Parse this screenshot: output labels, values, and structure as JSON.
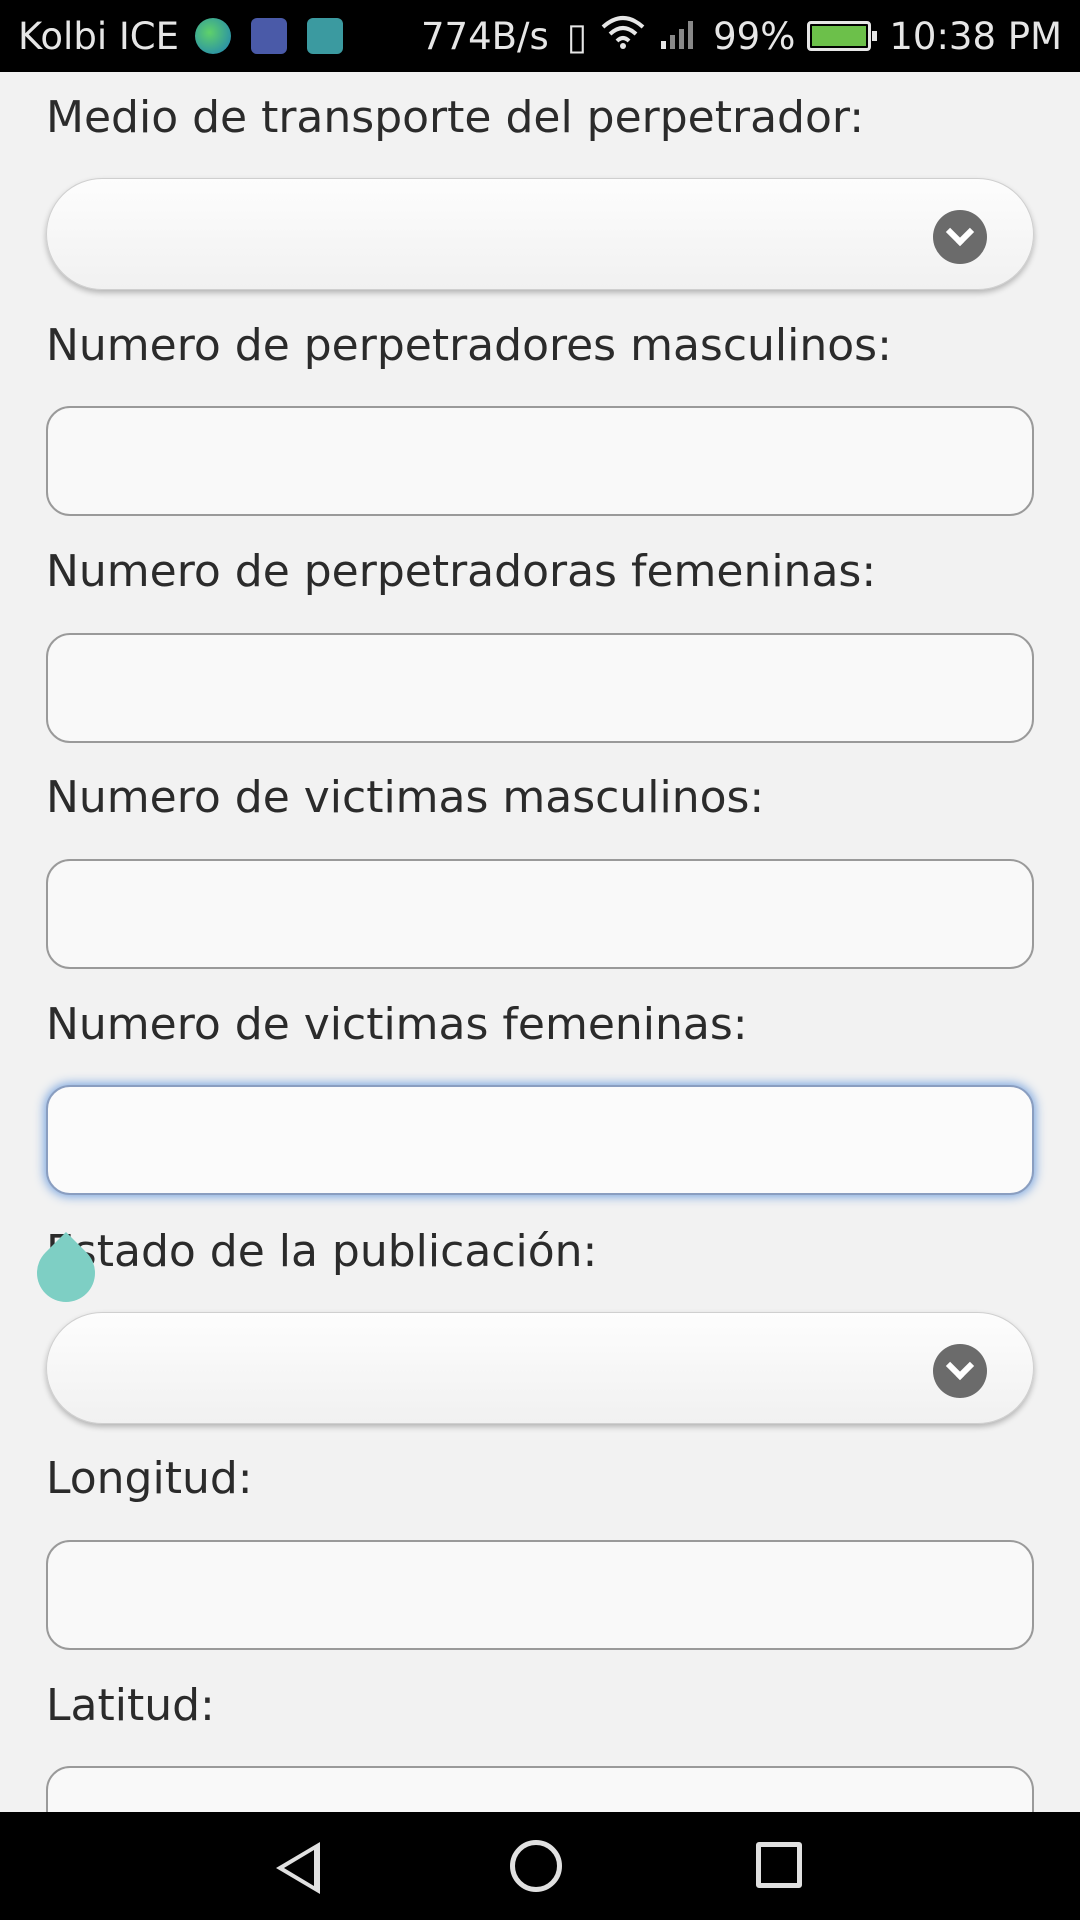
{
  "status_bar": {
    "carrier": "Kolbi ICE",
    "notification_icons": [
      "globe-icon",
      "health-icon",
      "gallery-icon"
    ],
    "net_speed": "774B/s",
    "battery_pct": "99%",
    "battery_level": 0.99,
    "battery_color": "#6cc04a",
    "time": "10:38 PM"
  },
  "form": {
    "transport_label": "Medio de transporte del perpetrador:",
    "transport_value": "",
    "male_perpetrators_label": "Numero de perpetradores masculinos:",
    "male_perpetrators_value": "",
    "female_perpetrators_label": "Numero de perpetradoras femeninas:",
    "female_perpetrators_value": "",
    "male_victims_label": "Numero de victimas masculinos:",
    "male_victims_value": "",
    "female_victims_label": "Numero de victimas femeninas:",
    "female_victims_value": "",
    "publication_status_label": "Estado de la publicación:",
    "publication_status_value": "",
    "longitude_label": "Longitud:",
    "longitude_value": "",
    "latitude_label": "Latitud:",
    "latitude_value": ""
  },
  "colors": {
    "focus_ring": "#7ea8e0",
    "cursor_handle": "#7ecfc4"
  },
  "nav_bar": {
    "icons": [
      "back-icon",
      "home-icon",
      "recents-icon"
    ]
  }
}
